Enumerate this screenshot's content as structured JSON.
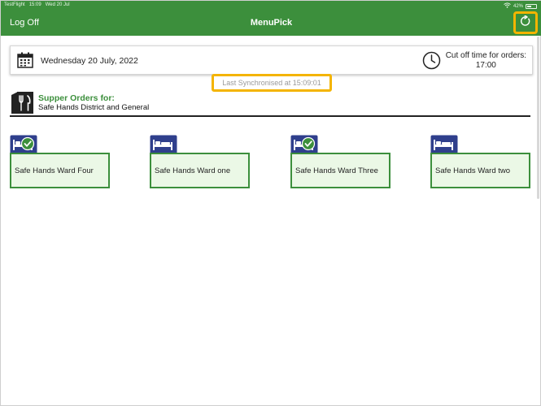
{
  "status_bar": {
    "carrier": "TestFlight",
    "time": "15:09",
    "date": "Wed 20 Jul",
    "battery": "42%"
  },
  "header": {
    "log_off": "Log Off",
    "title": "MenuPick"
  },
  "date_bar": {
    "date": "Wednesday 20 July, 2022",
    "cutoff_label": "Cut off time for orders:",
    "cutoff_time": "17:00"
  },
  "sync": {
    "text": "Last Synchronised at 15:09:01"
  },
  "orders": {
    "heading": "Supper Orders for:",
    "hospital": "Safe Hands District and General"
  },
  "wards": [
    {
      "name": "Safe Hands Ward Four",
      "completed": true
    },
    {
      "name": "Safe Hands Ward one",
      "completed": false
    },
    {
      "name": "Safe Hands Ward Three",
      "completed": true
    },
    {
      "name": "Safe Hands Ward two",
      "completed": false
    }
  ],
  "colors": {
    "brand_green": "#3c8f3c",
    "highlight": "#f4b400",
    "icon_blue": "#2f3f8c",
    "card_bg": "#ebf8e6"
  }
}
